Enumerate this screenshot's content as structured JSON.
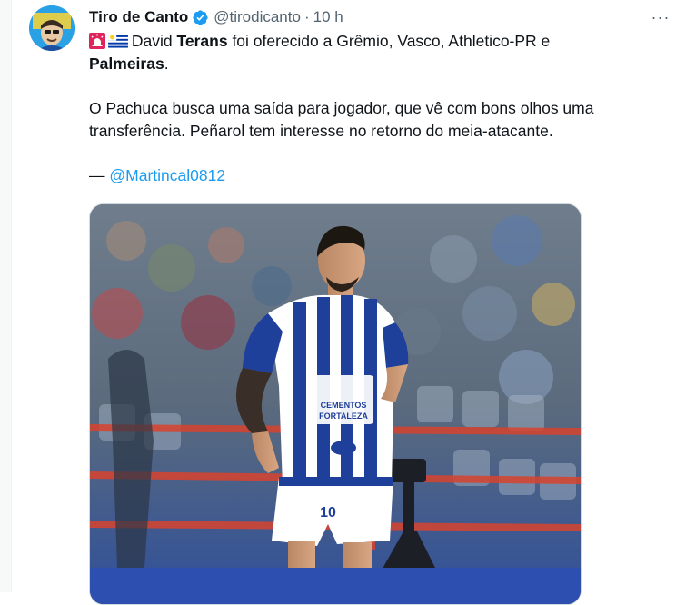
{
  "tweet": {
    "author_name": "Tiro de Canto",
    "handle": "@tirodicanto",
    "separator": "·",
    "time": "10 h",
    "more_label": "···",
    "text": {
      "line1_a": "David ",
      "line1_bold": "Terans",
      "line1_b": " foi oferecido a Grêmio, Vasco, Athletico-PR e",
      "line2_bold": "Palmeiras",
      "line2_end": ".",
      "para2": "O Pachuca busca uma saída para jogador, que vê com bons olhos uma transferência. Peñarol tem interesse no retorno do meia-atacante.",
      "credit_dash": "— ",
      "credit_mention": "@Martincal0812"
    },
    "media": {
      "jersey_sponsor_top": "CEMENTOS",
      "jersey_sponsor_bottom": "FORTALEZA",
      "player_number": "10"
    }
  },
  "icons": [
    "siren-emoji-icon",
    "uruguay-flag-icon",
    "verified-badge-icon",
    "more-options-icon"
  ],
  "colors": {
    "verified": "#1d9bf0",
    "link": "#1d9bf0",
    "secondary": "#536471",
    "siren": "#e0245e"
  }
}
